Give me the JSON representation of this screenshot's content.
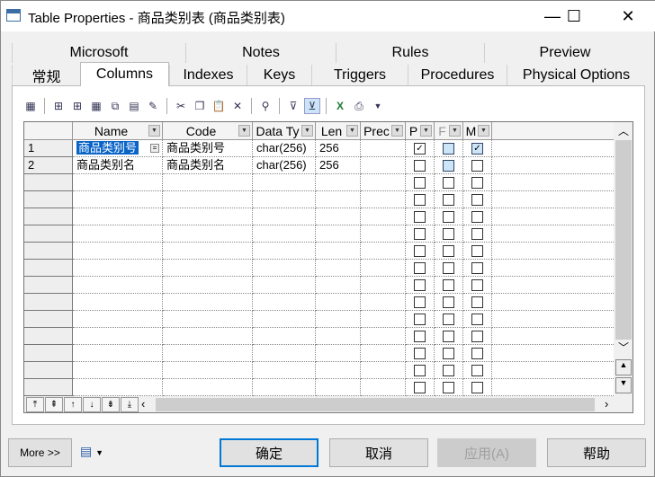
{
  "window": {
    "title": "Table Properties - 商品类别表 (商品类别表)",
    "minimize": "—",
    "maximize": "☐",
    "close": "✕"
  },
  "tabs_row1": [
    "Microsoft",
    "Notes",
    "Rules",
    "Preview"
  ],
  "tabs_row2": [
    "常规",
    "Columns",
    "Indexes",
    "Keys",
    "Triggers",
    "Procedures",
    "Physical Options"
  ],
  "active_tab": "Columns",
  "toolbar_icons": [
    "properties-icon",
    "insert-row-icon",
    "add-row-icon",
    "add-columns-icon",
    "replicate-icon",
    "paste-attributes-icon",
    "clear-icon",
    "cut-icon",
    "copy-icon",
    "paste-icon",
    "delete-icon",
    "find-icon",
    "filter-icon",
    "customize-columns-icon",
    "excel-icon",
    "print-icon"
  ],
  "columns": [
    "Name",
    "Code",
    "Data Ty",
    "Len",
    "Prec",
    "P",
    "F",
    "M"
  ],
  "rows": [
    {
      "num": "1",
      "name": "商品类别号",
      "code": "商品类别号",
      "type": "char(256)",
      "len": "256",
      "prec": "",
      "p": true,
      "f": false,
      "f_blue": true,
      "m": true
    },
    {
      "num": "2",
      "name": "商品类别名",
      "code": "商品类别名",
      "type": "char(256)",
      "len": "256",
      "prec": "",
      "p": false,
      "f": false,
      "f_blue": true,
      "m": false
    }
  ],
  "empty_rows": 13,
  "footer": {
    "more": "More >>",
    "ok": "确定",
    "cancel": "取消",
    "apply": "应用(A)",
    "help": "帮助"
  },
  "colors": {
    "selection": "#0a64c8",
    "focus_border": "#0078d7"
  }
}
